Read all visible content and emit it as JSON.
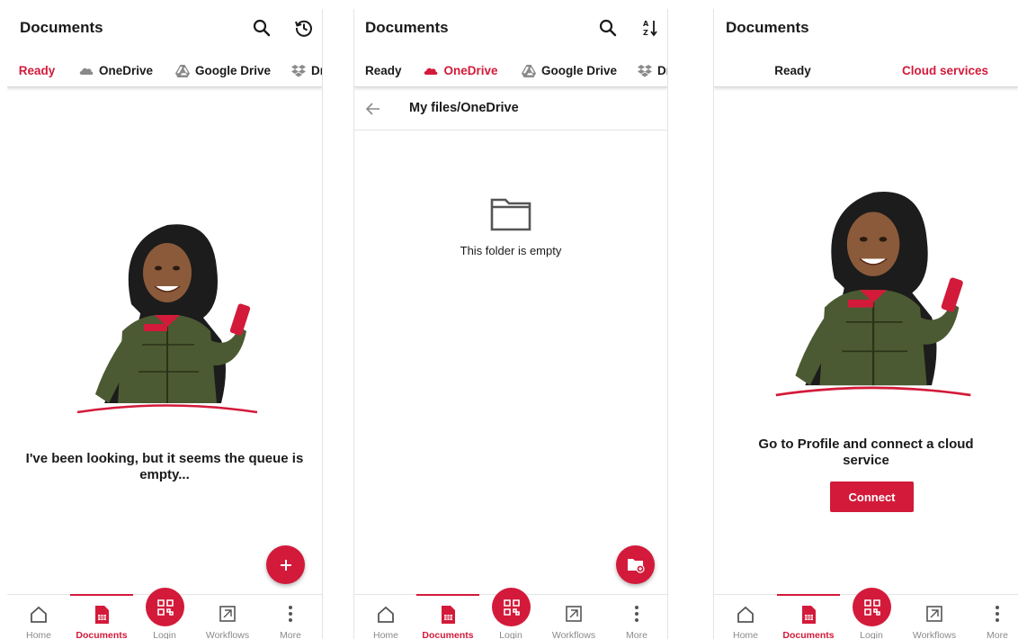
{
  "colors": {
    "accent": "#d31a3a",
    "text": "#1a1a1a",
    "muted": "#8a8a8a"
  },
  "panel1": {
    "title": "Documents",
    "actions": [
      "search-icon",
      "history-icon"
    ],
    "tabs": [
      {
        "label": "Ready",
        "icon": "",
        "active": true
      },
      {
        "label": "OneDrive",
        "icon": "onedrive-icon",
        "active": false
      },
      {
        "label": "Google Drive",
        "icon": "google-drive-icon",
        "active": false
      },
      {
        "label": "Dr",
        "icon": "dropbox-icon",
        "active": false
      }
    ],
    "message": "I've been looking, but it seems the queue is empty...",
    "fab_icon": "plus-icon"
  },
  "panel2": {
    "title": "Documents",
    "actions": [
      "search-icon",
      "sort-az-icon"
    ],
    "tabs": [
      {
        "label": "Ready",
        "icon": "",
        "active": false
      },
      {
        "label": "OneDrive",
        "icon": "onedrive-icon",
        "active": true
      },
      {
        "label": "Google Drive",
        "icon": "google-drive-icon",
        "active": false
      },
      {
        "label": "Dr",
        "icon": "dropbox-icon",
        "active": false
      }
    ],
    "path": "My files/OneDrive",
    "empty_text": "This folder is empty",
    "fab_icon": "new-folder-icon"
  },
  "panel3": {
    "title": "Documents",
    "tabs": [
      {
        "label": "Ready",
        "active": false
      },
      {
        "label": "Cloud services",
        "active": true
      }
    ],
    "message": "Go to Profile and connect a cloud service",
    "connect_label": "Connect"
  },
  "bottom_nav": [
    {
      "label": "Home",
      "icon": "home-icon",
      "active": false
    },
    {
      "label": "Documents",
      "icon": "documents-icon",
      "active": true
    },
    {
      "label": "Login",
      "icon": "qr-code-icon",
      "active": false
    },
    {
      "label": "Workflows",
      "icon": "workflows-icon",
      "active": false
    },
    {
      "label": "More",
      "icon": "more-vert-icon",
      "active": false
    }
  ]
}
